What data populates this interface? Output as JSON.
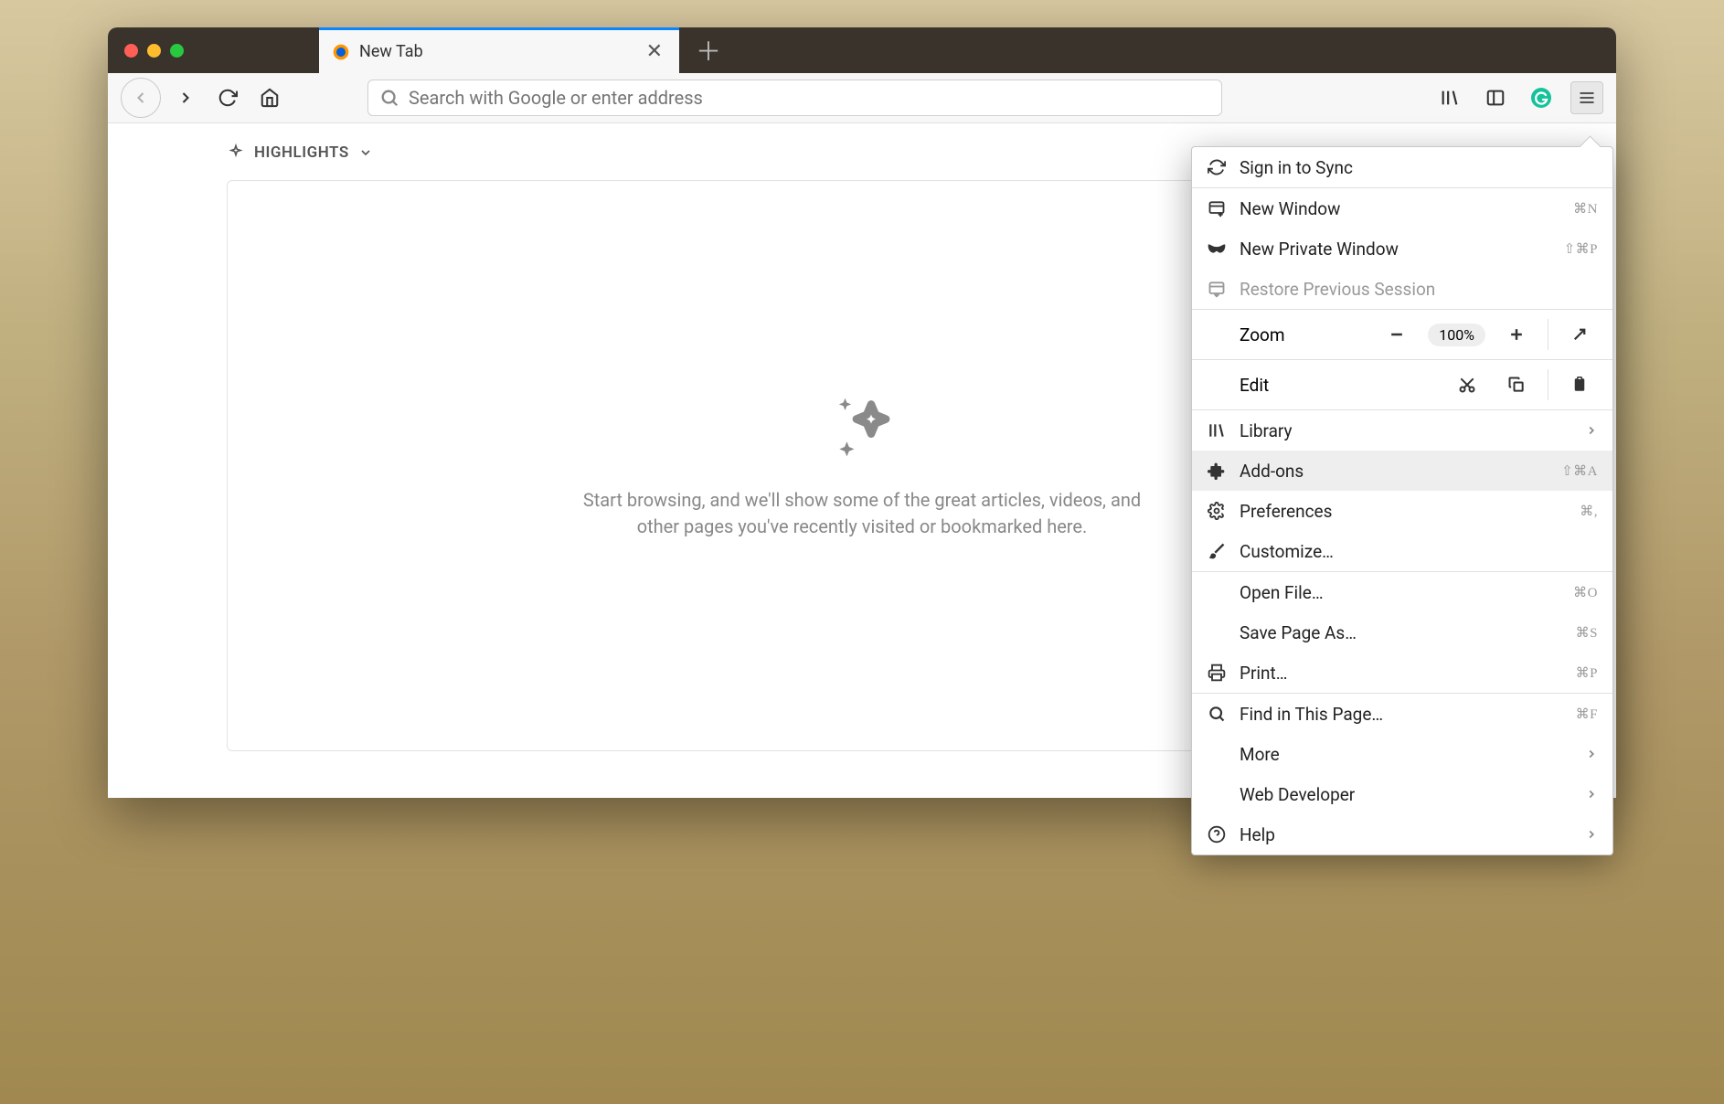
{
  "tab": {
    "title": "New Tab"
  },
  "urlbar": {
    "placeholder": "Search with Google or enter address"
  },
  "highlights": {
    "header": "HIGHLIGHTS",
    "body": "Start browsing, and we'll show some of the great articles, videos, and other pages you've recently visited or bookmarked here."
  },
  "menu": {
    "sign_in": "Sign in to Sync",
    "new_window": {
      "label": "New Window",
      "shortcut": "⌘N"
    },
    "new_private": {
      "label": "New Private Window",
      "shortcut": "⇧⌘P"
    },
    "restore": {
      "label": "Restore Previous Session"
    },
    "zoom": {
      "label": "Zoom",
      "value": "100%"
    },
    "edit": {
      "label": "Edit"
    },
    "library": {
      "label": "Library"
    },
    "addons": {
      "label": "Add-ons",
      "shortcut": "⇧⌘A"
    },
    "preferences": {
      "label": "Preferences",
      "shortcut": "⌘,"
    },
    "customize": {
      "label": "Customize…"
    },
    "open_file": {
      "label": "Open File…",
      "shortcut": "⌘O"
    },
    "save_page": {
      "label": "Save Page As…",
      "shortcut": "⌘S"
    },
    "print": {
      "label": "Print…",
      "shortcut": "⌘P"
    },
    "find": {
      "label": "Find in This Page…",
      "shortcut": "⌘F"
    },
    "more": {
      "label": "More"
    },
    "webdev": {
      "label": "Web Developer"
    },
    "help": {
      "label": "Help"
    }
  }
}
